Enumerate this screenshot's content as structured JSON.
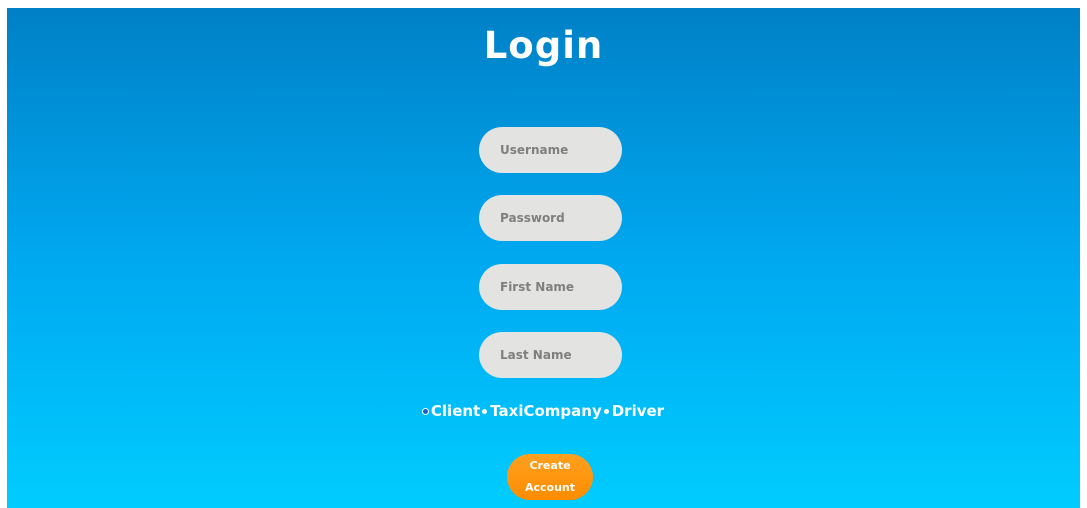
{
  "page": {
    "title": "Login"
  },
  "form": {
    "username": {
      "placeholder": "Username",
      "value": ""
    },
    "password": {
      "placeholder": "Password",
      "value": ""
    },
    "first_name": {
      "placeholder": "First Name",
      "value": ""
    },
    "last_name": {
      "placeholder": "Last Name",
      "value": ""
    }
  },
  "roles": {
    "options": [
      {
        "label": "Client",
        "selected": true
      },
      {
        "label": "TaxiCompany",
        "selected": false
      },
      {
        "label": "Driver",
        "selected": false
      }
    ]
  },
  "actions": {
    "create_account_label": "Create Account"
  },
  "colors": {
    "background_top": "#0080c6",
    "background_bottom": "#00ccff",
    "field_bg": "#e3e3e1",
    "button": "#ff8c00"
  }
}
